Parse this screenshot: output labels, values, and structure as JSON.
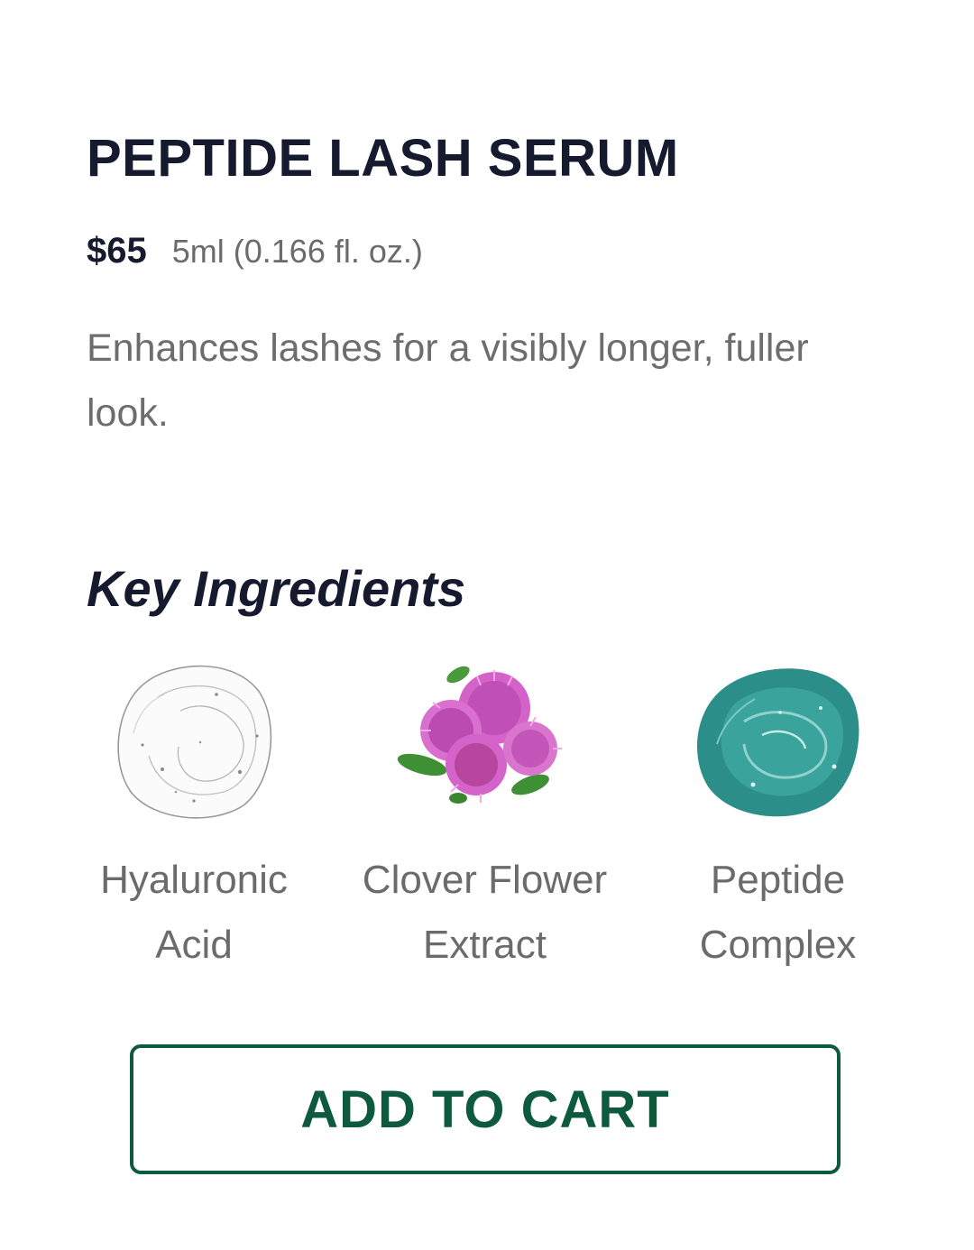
{
  "product": {
    "title": "PEPTIDE LASH SERUM",
    "price": "$65",
    "size": "5ml (0.166 fl. oz.)",
    "description": "Enhances lashes for a visibly longer, fuller look."
  },
  "ingredients": {
    "heading": "Key Ingredients",
    "items": [
      {
        "line1": "Hyaluronic",
        "line2": "Acid",
        "icon": "clear-gel-swatch-icon"
      },
      {
        "line1": "Clover Flower",
        "line2": "Extract",
        "icon": "clover-flower-icon"
      },
      {
        "line1": "Peptide",
        "line2": "Complex",
        "icon": "teal-gel-swatch-icon"
      }
    ]
  },
  "cart": {
    "label": "ADD TO CART"
  },
  "colors": {
    "title": "#161a2e",
    "text_muted": "#6b6b6b",
    "accent": "#0d5a3e",
    "gel_teal": "#2a8f8a",
    "clover_pink": "#c04fb8"
  }
}
